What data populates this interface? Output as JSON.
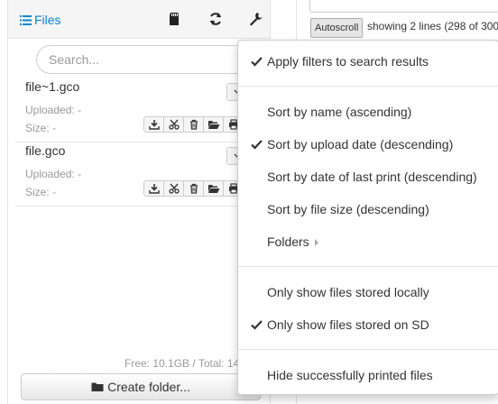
{
  "files_panel": {
    "title": "Files",
    "search": {
      "placeholder": "Search..."
    },
    "files": [
      {
        "name": "file~1.gco",
        "uploaded_label": "Uploaded:",
        "uploaded_value": "-",
        "size_label": "Size:",
        "size_value": "-"
      },
      {
        "name": "file.gco",
        "uploaded_label": "Uploaded:",
        "uploaded_value": "-",
        "size_label": "Size:",
        "size_value": "-"
      }
    ],
    "storage_text": "Free: 10.1GB / Total: 14",
    "create_folder_label": "Create folder..."
  },
  "terminal": {
    "autoscroll_label": "Autoscroll",
    "showing_text": "showing 2 lines (298 of 300"
  },
  "menu": {
    "items": [
      {
        "label": "Apply filters to search results",
        "checked": true
      },
      {
        "label": "Sort by name (ascending)",
        "checked": false
      },
      {
        "label": "Sort by upload date (descending)",
        "checked": true
      },
      {
        "label": "Sort by date of last print (descending)",
        "checked": false
      },
      {
        "label": "Sort by file size (descending)",
        "checked": false
      },
      {
        "label": "Folders",
        "checked": false,
        "submenu": true
      },
      {
        "label": "Only show files stored locally",
        "checked": false
      },
      {
        "label": "Only show files stored on SD",
        "checked": true
      },
      {
        "label": "Hide successfully printed files",
        "checked": false
      }
    ]
  },
  "colors": {
    "link_blue": "#0088cc",
    "icon_dark": "#222222",
    "muted_text": "#999999"
  }
}
